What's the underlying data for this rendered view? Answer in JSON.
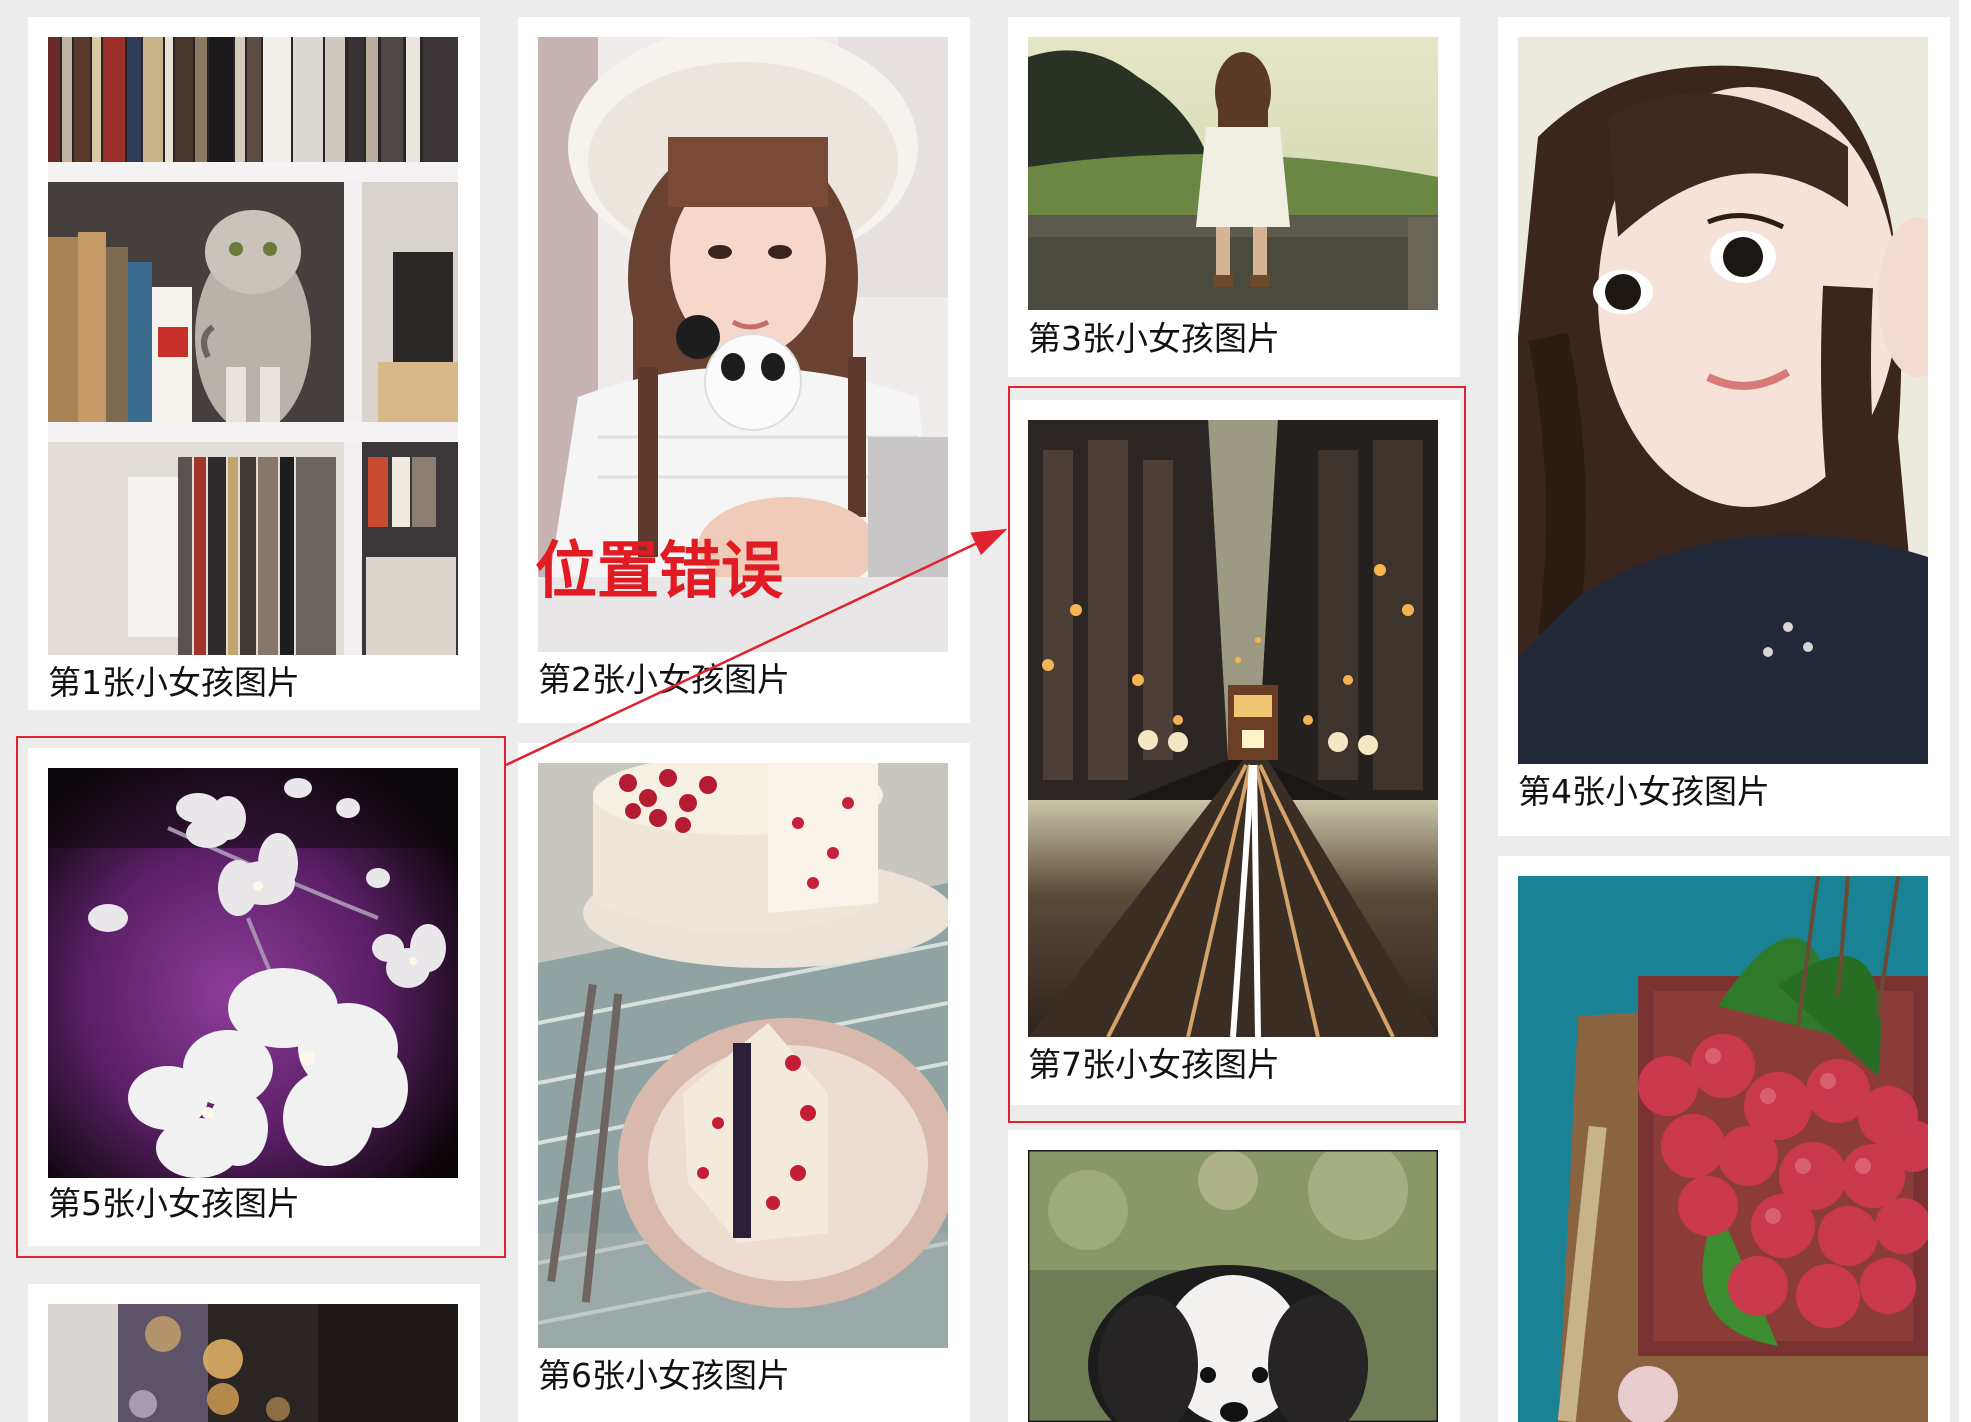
{
  "gallery": {
    "items": [
      {
        "caption": "第1张小女孩图片",
        "image": "cat-on-bookshelf"
      },
      {
        "caption": "第2张小女孩图片",
        "image": "girl-in-fur-hat"
      },
      {
        "caption": "第3张小女孩图片",
        "image": "girl-sitting-on-fence"
      },
      {
        "caption": "第4张小女孩图片",
        "image": "girl-portrait"
      },
      {
        "caption": "第5张小女孩图片",
        "image": "white-flowers"
      },
      {
        "caption": "第6张小女孩图片",
        "image": "raspberry-cake"
      },
      {
        "caption": "第7张小女孩图片",
        "image": "city-street-tram"
      },
      {
        "caption": "",
        "image": "bokeh-lights-partial"
      },
      {
        "caption": "",
        "image": "dog-partial"
      },
      {
        "caption": "",
        "image": "lychee-fruit-partial"
      }
    ]
  },
  "annotation": {
    "label": "位置错误",
    "color": "#e11b23"
  }
}
